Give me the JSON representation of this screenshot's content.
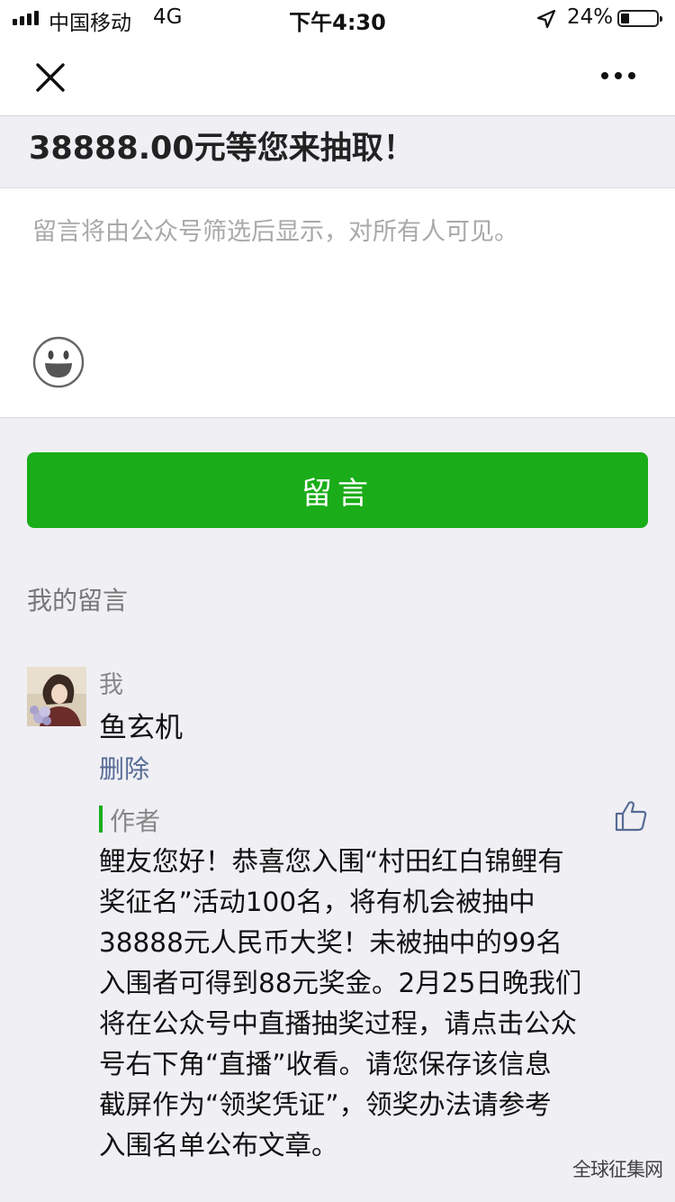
{
  "status_bar": {
    "carrier": "中国移动",
    "network": "4G",
    "time": "下午4:30",
    "battery_percent": "24%",
    "battery_level": 0.24
  },
  "nav": {
    "close_icon": "close-icon",
    "more_icon": "more-icon"
  },
  "headline": "38888.00元等您来抽取！",
  "comment_box": {
    "placeholder": "留言将由公众号筛选后显示，对所有人可见。",
    "emoji_icon": "smiley-icon"
  },
  "send_button": "留言",
  "my_comments": {
    "section_title": "我的留言",
    "user_label": "我",
    "comment_text": "鱼玄机",
    "delete_label": "删除"
  },
  "author_reply": {
    "label": "作者",
    "like_icon": "thumbs-up-icon",
    "text": "鲤友您好！恭喜您入围“村田红白锦鲤有\n奖征名”活动100名，将有机会被抽中\n38888元人民币大奖！未被抽中的99名\n入围者可得到88元奖金。2月25日晚我们\n将在公众号中直播抽奖过程，请点击公众\n号右下角“直播”收看。请您保存该信息\n截屏作为“领奖凭证”，领奖办法请参考\n入围名单公布文章。"
  },
  "watermark": "全球征集网",
  "colors": {
    "accent_green": "#1aad19",
    "link_blue": "#576b95",
    "background": "#efeff4"
  }
}
